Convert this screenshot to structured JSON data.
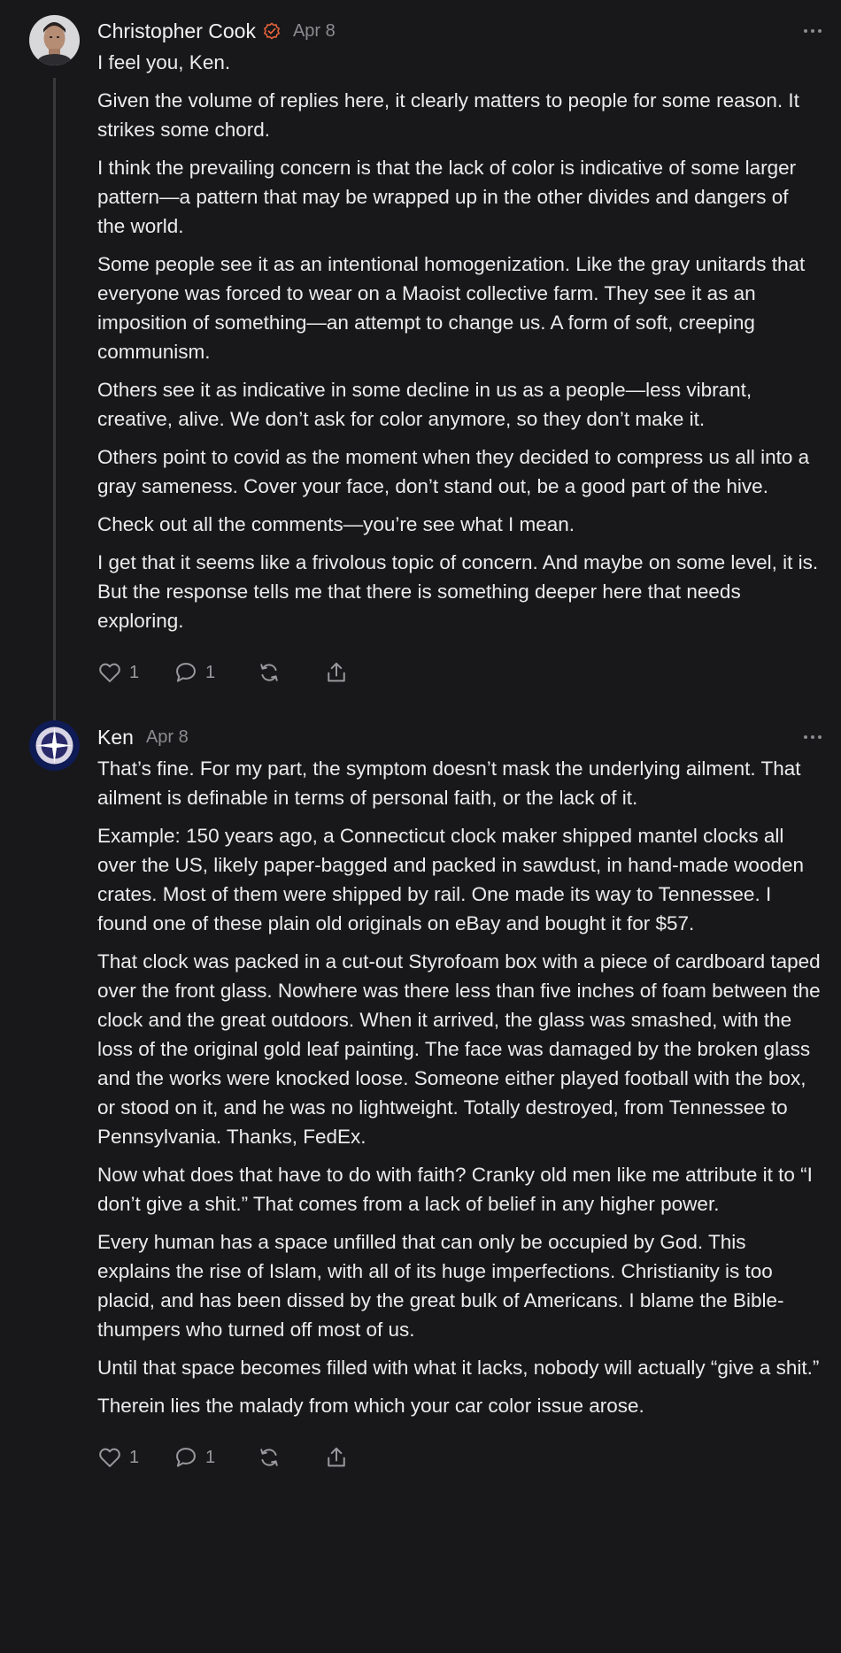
{
  "comments": [
    {
      "author": "Christopher Cook",
      "verified": true,
      "date": "Apr 8",
      "avatar_icon": "person-photo",
      "paragraphs": [
        "I feel you, Ken.",
        "Given the volume of replies here, it clearly matters to people for some reason. It strikes some chord.",
        "I think the prevailing concern is that the lack of color is indicative of some larger pattern—a pattern that may be wrapped up in the other divides and dangers of the world.",
        "Some people see it as an intentional homogenization. Like the gray unitards that everyone was forced to wear on a Maoist collective farm. They see it as an imposition of something—an attempt to change us. A form of soft, creeping communism.",
        "Others see it as indicative in some decline in us as a people—less vibrant, creative, alive. We don’t ask for color anymore, so they don’t make it.",
        "Others point to covid as the moment when they decided to compress us all into a gray sameness. Cover your face, don’t stand out, be a good part of the hive.",
        "Check out all the comments—you’re see what I mean.",
        "I get that it seems like a frivolous topic of concern. And maybe on some level, it is. But the response tells me that there is something deeper here that needs exploring."
      ],
      "likes": "1",
      "replies": "1"
    },
    {
      "author": "Ken",
      "verified": false,
      "date": "Apr 8",
      "avatar_icon": "star-emblem",
      "paragraphs": [
        "That’s fine. For my part, the symptom doesn’t mask the underlying ailment. That ailment is definable in terms of personal faith, or the lack of it.",
        "Example: 150 years ago, a Connecticut clock maker shipped mantel clocks all over the US, likely paper-bagged and packed in sawdust, in hand-made wooden crates. Most of them were shipped by rail. One made its way to Tennessee. I found one of these plain old originals on eBay and bought it for $57.",
        "That clock was packed in a cut-out Styrofoam box with a piece of cardboard taped over the front glass. Nowhere was there less than five inches of foam between the clock and the great outdoors. When it arrived, the glass was smashed, with the loss of the original gold leaf painting. The face was damaged by the broken glass and the works were knocked loose. Someone either played football with the box, or stood on it, and he was no lightweight. Totally destroyed, from Tennessee to Pennsylvania. Thanks, FedEx.",
        "Now what does that have to do with faith? Cranky old men like me attribute it to “I don’t give a shit.” That comes from a lack of belief in any higher power.",
        "Every human has a space unfilled that can only be occupied by God. This explains the rise of Islam, with all of its huge imperfections. Christianity is too placid, and has been dissed by the great bulk of Americans. I blame the Bible-thumpers who turned off most of us.",
        "Until that space becomes filled with what it lacks, nobody will actually “give a shit.”",
        "Therein lies the malady from which your car color issue arose."
      ],
      "likes": "1",
      "replies": "1"
    }
  ],
  "colors": {
    "background": "#18181a",
    "text": "#ececec",
    "muted": "#8c8c90",
    "verified_accent": "#e8643a",
    "thread_line": "#3a3a3d"
  },
  "icons": [
    "heart-icon",
    "comment-icon",
    "restack-icon",
    "share-icon",
    "more-icon",
    "verified-icon"
  ]
}
